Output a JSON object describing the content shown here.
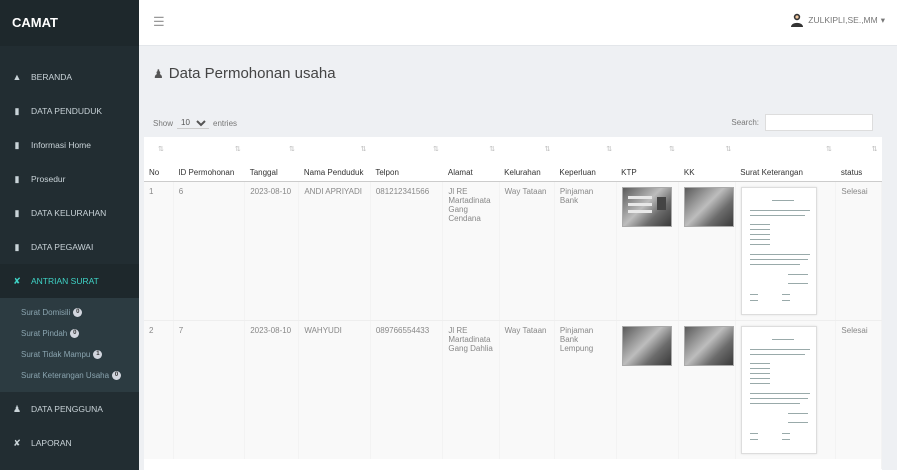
{
  "sidebar": {
    "brand": "CAMAT",
    "items": [
      {
        "label": "BERANDA",
        "icon": "home-icon"
      },
      {
        "label": "DATA PENDUDUK",
        "icon": "file-icon"
      },
      {
        "label": "Informasi Home",
        "icon": "file-icon"
      },
      {
        "label": "Prosedur",
        "icon": "file-icon"
      },
      {
        "label": "DATA KELURAHAN",
        "icon": "file-icon"
      },
      {
        "label": "DATA PEGAWAI",
        "icon": "file-icon"
      },
      {
        "label": "ANTRIAN SURAT",
        "icon": "tools-icon"
      }
    ],
    "sub_items": [
      {
        "label": "Surat Domisili",
        "badge": "0"
      },
      {
        "label": "Surat Pindah",
        "badge": "0"
      },
      {
        "label": "Surat Tidak Mampu",
        "badge": "1"
      },
      {
        "label": "Surat Keterangan Usaha",
        "badge": "0"
      }
    ],
    "bottom_items": [
      {
        "label": "DATA PENGGUNA",
        "icon": "user-icon"
      },
      {
        "label": "LAPORAN",
        "icon": "tools-icon"
      }
    ],
    "colors": {
      "bg": "#222d32",
      "active": "#3fd3c6"
    }
  },
  "header": {
    "user_name": "ZULKIPLI,SE.,MM",
    "caret": "▾"
  },
  "main": {
    "title": "Data Permohonan usaha",
    "show_label": "Show",
    "entries_value": "10",
    "entries_label": "entries",
    "search_label": "Search:",
    "search_value": "",
    "columns": [
      "No",
      "ID Permohonan",
      "Tanggal",
      "Nama Penduduk",
      "Telpon",
      "Alamat",
      "Kelurahan",
      "Keperluan",
      "KTP",
      "KK",
      "Surat Keterangan",
      "status"
    ],
    "rows": [
      {
        "no": "1",
        "id": "6",
        "tanggal": "2023-08-10",
        "nama": "ANDI APRIYADI",
        "telpon": "081212341566",
        "alamat": "Jl RE Martadinata Gang Cendana",
        "kelurahan": "Way Tataan",
        "keperluan": "Pinjaman Bank",
        "status": "Selesai"
      },
      {
        "no": "2",
        "id": "7",
        "tanggal": "2023-08-10",
        "nama": "WAHYUDI",
        "telpon": "089766554433",
        "alamat": "Jl RE Martadinata Gang Dahlia",
        "kelurahan": "Way Tataan",
        "keperluan": "Pinjaman Bank Lempung",
        "status": "Selesai"
      }
    ]
  }
}
